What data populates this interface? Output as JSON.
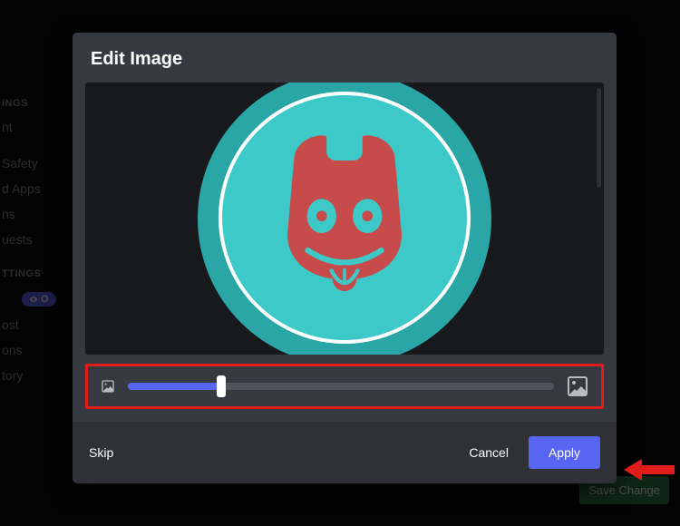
{
  "background": {
    "sidebar_heading_1": "INGS",
    "sidebar_items_1": [
      "nt",
      "",
      "Safety",
      "d Apps",
      "ns",
      "uests"
    ],
    "sidebar_heading_2": "TTINGS",
    "pill_label": "O",
    "sidebar_items_2": [
      "ost",
      "ons",
      "tory"
    ],
    "save_label": "Save Change"
  },
  "modal": {
    "title": "Edit Image",
    "zoom": {
      "value_pct": 22
    },
    "footer": {
      "skip_label": "Skip",
      "cancel_label": "Cancel",
      "apply_label": "Apply"
    }
  },
  "colors": {
    "accent": "#5865f2",
    "modal_bg": "#36393f",
    "footer_bg": "#2f3136",
    "editor_bg": "#18191c",
    "avatar_teal": "#3ec9c9",
    "avatar_teal_dark": "#2aa6a6",
    "avatar_red": "#c84b4b",
    "highlight_red": "#e21b1b",
    "save_green": "#2d7d46"
  }
}
